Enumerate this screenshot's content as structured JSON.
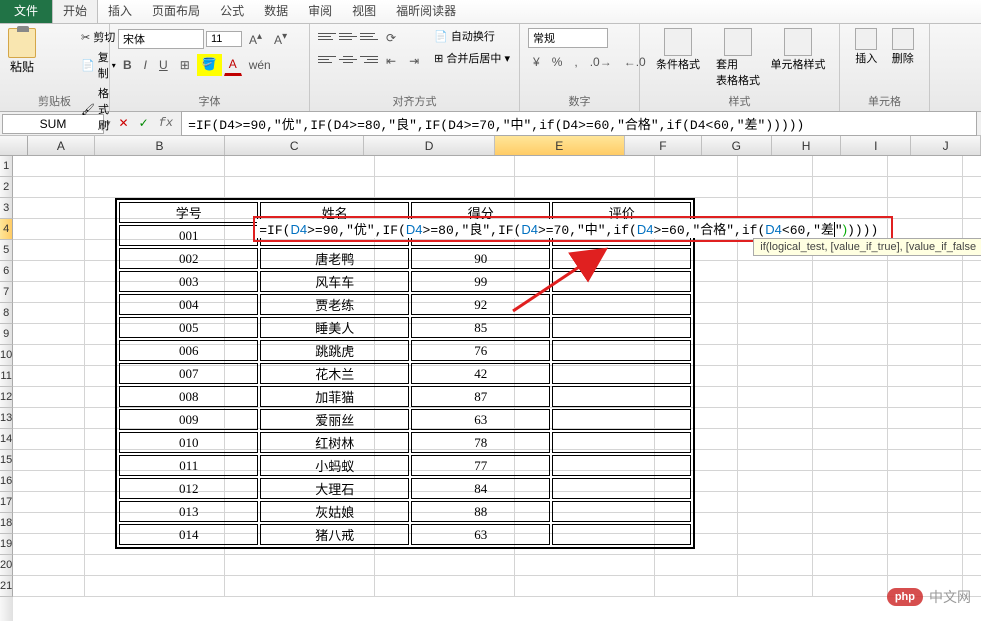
{
  "tabs": {
    "file": "文件",
    "items": [
      "开始",
      "插入",
      "页面布局",
      "公式",
      "数据",
      "审阅",
      "视图",
      "福昕阅读器"
    ],
    "active": "开始"
  },
  "ribbon": {
    "clipboard": {
      "label": "剪贴板",
      "paste": "粘贴",
      "cut": "剪切",
      "copy": "复制",
      "format": "格式刷"
    },
    "font": {
      "label": "字体",
      "family": "宋体",
      "size": "11"
    },
    "align": {
      "label": "对齐方式",
      "wrap": "自动换行",
      "merge": "合并后居中"
    },
    "number": {
      "label": "数字",
      "general": "常规"
    },
    "style": {
      "label": "样式",
      "cond": "条件格式",
      "table": "套用\n表格格式",
      "cell": "单元格样式"
    },
    "cells": {
      "label": "单元格",
      "insert": "插入",
      "delete": "删除"
    }
  },
  "formula_bar": {
    "name_box": "SUM",
    "formula": "=IF(D4>=90,\"优\",IF(D4>=80,\"良\",IF(D4>=70,\"中\",if(D4>=60,\"合格\",if(D4<60,\"差\")))))"
  },
  "columns": [
    "A",
    "B",
    "C",
    "D",
    "E",
    "F",
    "G",
    "H",
    "I",
    "J"
  ],
  "selected_col": "E",
  "selected_row": 4,
  "table": {
    "headers": [
      "学号",
      "姓名",
      "得分",
      "评价"
    ],
    "rows": [
      [
        "001",
        "",
        "",
        ""
      ],
      [
        "002",
        "唐老鸭",
        "90",
        ""
      ],
      [
        "003",
        "风车车",
        "99",
        ""
      ],
      [
        "004",
        "贾老练",
        "92",
        ""
      ],
      [
        "005",
        "睡美人",
        "85",
        ""
      ],
      [
        "006",
        "跳跳虎",
        "76",
        ""
      ],
      [
        "007",
        "花木兰",
        "42",
        ""
      ],
      [
        "008",
        "加菲猫",
        "87",
        ""
      ],
      [
        "009",
        "爱丽丝",
        "63",
        ""
      ],
      [
        "010",
        "红树林",
        "78",
        ""
      ],
      [
        "011",
        "小蚂蚁",
        "77",
        ""
      ],
      [
        "012",
        "大理石",
        "84",
        ""
      ],
      [
        "013",
        "灰姑娘",
        "88",
        ""
      ],
      [
        "014",
        "猪八戒",
        "63",
        ""
      ]
    ]
  },
  "cell_formula_display": "=IF(D4>=90,\"优\",IF(D4>=80,\"良\",IF(D4>=70,\"中\",if(D4>=60,\"合格\",if(D4<60,\"差|\")))))",
  "tooltip": "if(logical_test, [value_if_true], [value_if_false",
  "watermark": {
    "badge": "php",
    "text": "中文网"
  }
}
